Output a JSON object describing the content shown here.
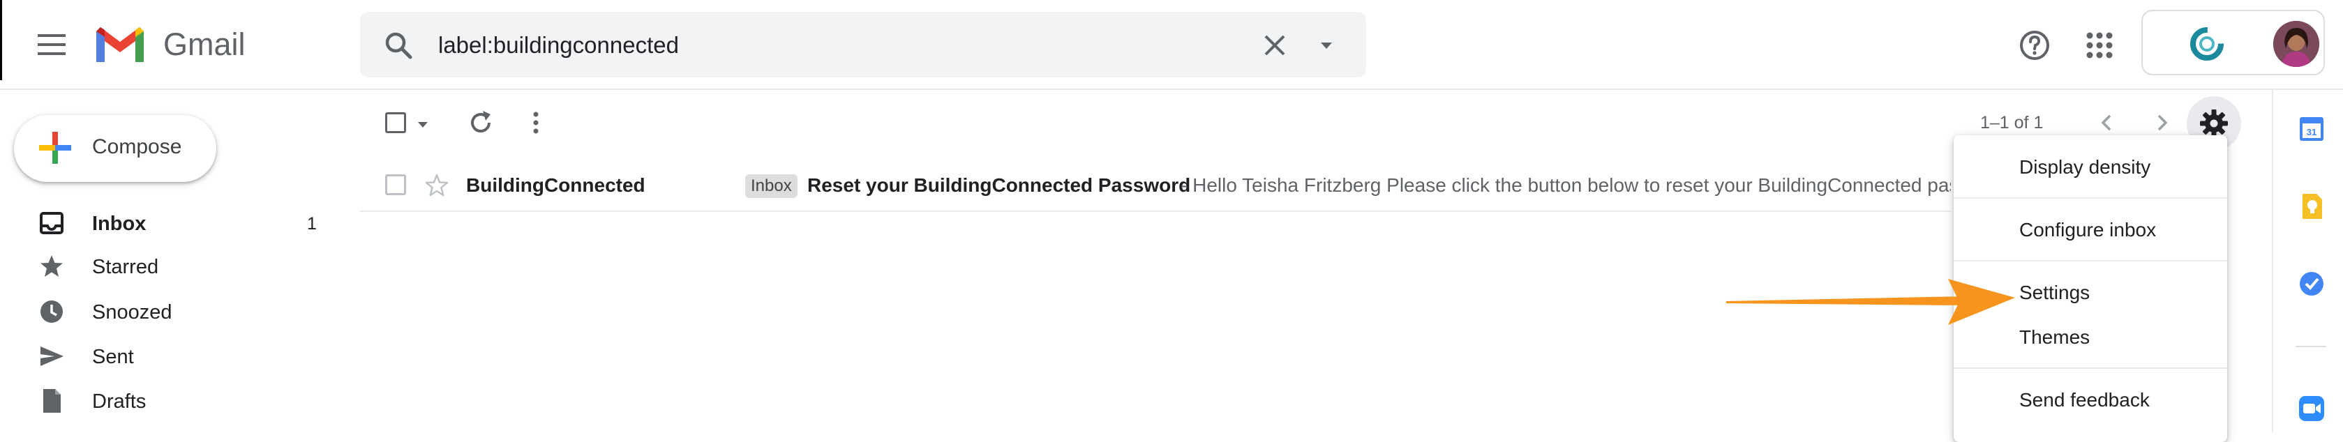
{
  "app": {
    "name": "Gmail"
  },
  "search": {
    "query": "label:buildingconnected"
  },
  "compose": {
    "label": "Compose"
  },
  "sidebar": {
    "items": [
      {
        "label": "Inbox",
        "count": "1",
        "icon": "inbox-icon"
      },
      {
        "label": "Starred",
        "count": "",
        "icon": "star-icon"
      },
      {
        "label": "Snoozed",
        "count": "",
        "icon": "clock-icon"
      },
      {
        "label": "Sent",
        "count": "",
        "icon": "send-icon"
      },
      {
        "label": "Drafts",
        "count": "",
        "icon": "draft-icon"
      }
    ]
  },
  "toolbar": {
    "pagination": "1–1 of 1"
  },
  "emails": [
    {
      "sender": "BuildingConnected",
      "label": "Inbox",
      "subject": "Reset your BuildingConnected Password",
      "snippet": " - Hello Teisha Fritzberg Please click the button below to reset your BuildingConnected password"
    }
  ],
  "settings_menu": {
    "items": [
      "Display density",
      "Configure inbox",
      "Settings",
      "Themes",
      "Send feedback"
    ]
  },
  "colors": {
    "gmail_red": "#EA4335",
    "search_bg": "#f1f3f4",
    "annotation_arrow": "#F7941D",
    "calendar_blue": "#4285F4",
    "keep_yellow": "#F6BF26"
  }
}
